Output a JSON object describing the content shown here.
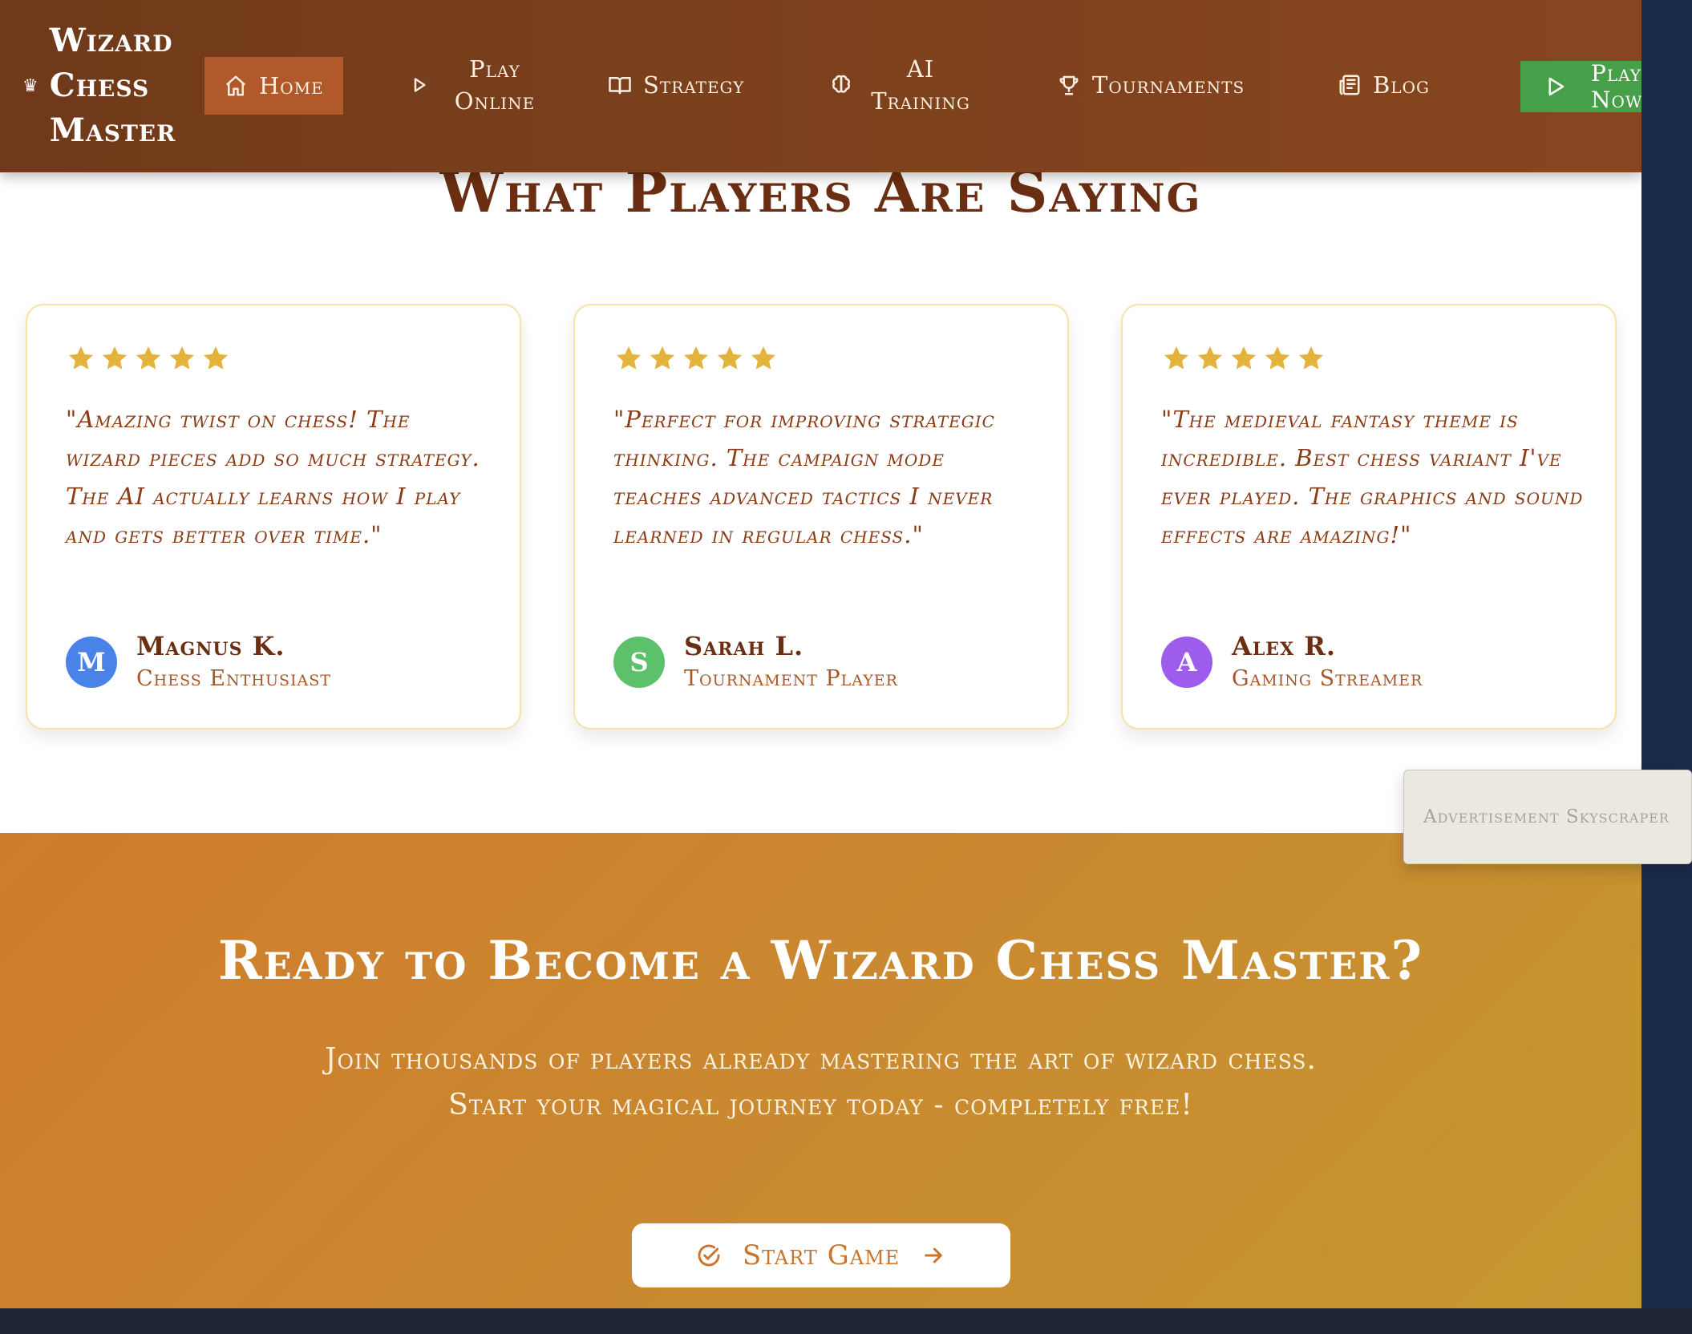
{
  "brand": {
    "name": "Wizard Chess Master",
    "crown_icon": "crown-icon"
  },
  "nav": {
    "home": "Home",
    "play_online": "Play Online",
    "strategy": "Strategy",
    "ai_training": "AI Training",
    "tournaments": "Tournaments",
    "blog": "Blog",
    "play_now": "Play Now"
  },
  "testimonials": {
    "title": "What Players Are Saying",
    "items": [
      {
        "rating": 5,
        "quote": "\"Amazing twist on chess! The wizard pieces add so much strategy. The AI actually learns how I play and gets better over time.\"",
        "initial": "M",
        "name": "Magnus K.",
        "role": "Chess Enthusiast",
        "avatar_color": "#4a83e8"
      },
      {
        "rating": 5,
        "quote": "\"Perfect for improving strategic thinking. The campaign mode teaches advanced tactics I never learned in regular chess.\"",
        "initial": "S",
        "name": "Sarah L.",
        "role": "Tournament Player",
        "avatar_color": "#5cc16a"
      },
      {
        "rating": 5,
        "quote": "\"The medieval fantasy theme is incredible. Best chess variant I've ever played. The graphics and sound effects are amazing!\"",
        "initial": "A",
        "name": "Alex R.",
        "role": "Gaming Streamer",
        "avatar_color": "#9d5cec"
      }
    ]
  },
  "ad": {
    "label": "Advertisement Skyscraper"
  },
  "cta": {
    "title": "Ready to Become a Wizard Chess Master?",
    "text": "Join thousands of players already mastering the art of wizard chess. Start your magical journey today - completely free!",
    "button": "Start Game"
  },
  "colors": {
    "nav_bg": "#7d411d",
    "nav_active": "#b1592a",
    "play_now_green": "#45a049",
    "title_brown": "#6b2e12",
    "star_gold": "#e4b33b",
    "cta_orange": "#cf7b2c"
  }
}
